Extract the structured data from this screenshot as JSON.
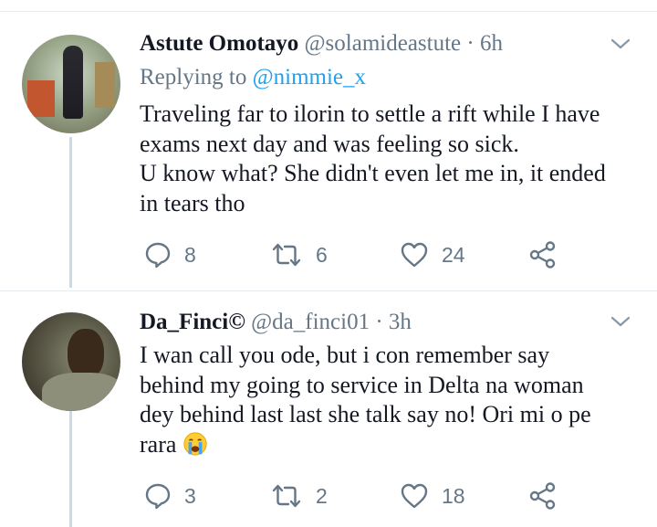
{
  "tweets": [
    {
      "name": "Astute Omotayo",
      "handle": "@solamideastute",
      "separator": "·",
      "time": "6h",
      "replying_prefix": "Replying to",
      "replying_to": "@nimmie_x",
      "text_lines": [
        "Traveling far to ilorin to settle a rift while I have",
        "exams next day and was feeling so sick.",
        "U know what? She didn't even let me in, it ended",
        "in tears tho"
      ],
      "replies": "8",
      "retweets": "6",
      "likes": "24"
    },
    {
      "name": "Da_Finci©",
      "handle": "@da_finci01",
      "separator": "·",
      "time": "3h",
      "text_lines": [
        "I wan call you ode, but i con remember  say",
        "behind my going to service in Delta na woman",
        "dey behind last last she talk say no! Ori mi o pe",
        "rara"
      ],
      "emoji": "crying-face-emoji",
      "replies": "3",
      "retweets": "2",
      "likes": "18"
    }
  ],
  "colors": {
    "primary_text": "#141823",
    "secondary_text": "#657786",
    "link": "#1da1f2",
    "divider": "#e6ecf0"
  }
}
